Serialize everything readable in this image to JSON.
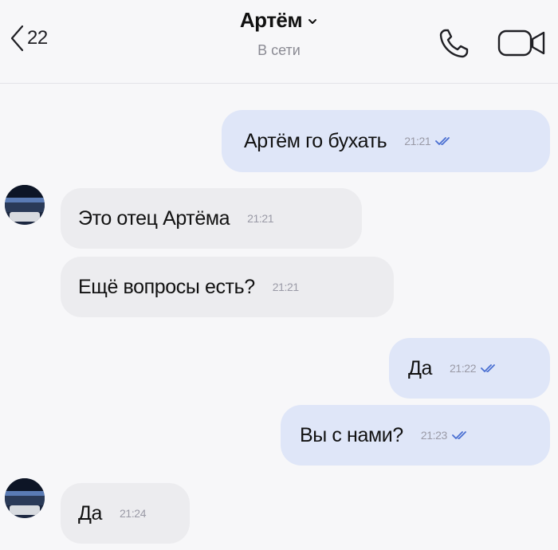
{
  "header": {
    "back_count": "22",
    "contact_name": "Артём",
    "status": "В сети"
  },
  "messages": [
    {
      "text": "Артём го бухать",
      "time": "21:21",
      "direction": "out"
    },
    {
      "text": "Это отец Артёма",
      "time": "21:21",
      "direction": "in"
    },
    {
      "text": "Ещё вопросы есть?",
      "time": "21:21",
      "direction": "in"
    },
    {
      "text": "Да",
      "time": "21:22",
      "direction": "out"
    },
    {
      "text": "Вы с нами?",
      "time": "21:23",
      "direction": "out"
    },
    {
      "text": "Да",
      "time": "21:24",
      "direction": "in"
    }
  ],
  "icons": {
    "back": "chevron-left-icon",
    "dropdown": "chevron-down-icon",
    "call": "phone-icon",
    "video": "video-camera-icon",
    "read": "double-check-icon"
  },
  "colors": {
    "outgoing_bubble": "#dfe6f8",
    "incoming_bubble": "#ececef",
    "read_ticks": "#4a6fd1",
    "timestamp": "#9a9aa6"
  }
}
